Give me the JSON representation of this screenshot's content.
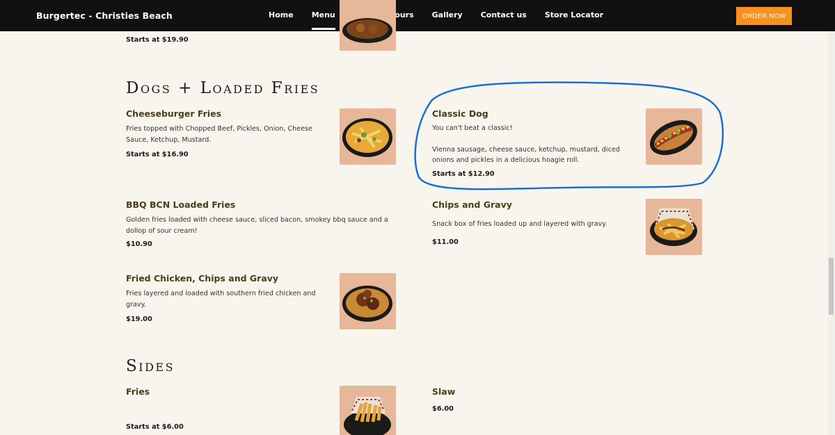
{
  "nav": {
    "brand": "Burgertec - Christies Beach",
    "links": [
      "Home",
      "Menu",
      "Trading Hours",
      "Gallery",
      "Contact us",
      "Store Locator"
    ],
    "order_label": "ORDER NOW"
  },
  "top_item": {
    "price": "Starts at $19.90"
  },
  "sections": [
    {
      "title": "Dogs + Loaded Fries",
      "items": [
        {
          "name": "Cheeseburger Fries",
          "desc": "Fries topped with Chopped Beef, Pickles, Onion, Cheese Sauce, Ketchup, Mustard.",
          "price": "Starts at $16.90"
        },
        {
          "name": "Classic Dog",
          "desc": "You can't beat a classic!",
          "desc2": "Vienna sausage, cheese sauce, ketchup, mustard, diced onions and pickles in a delicious hoagie roll.",
          "price": "Starts at $12.90"
        },
        {
          "name": "BBQ BCN Loaded Fries",
          "desc": "Golden fries loaded with cheese sauce, sliced bacon, smokey bbq sauce and a dollop of sour cream!",
          "price": "$10.90"
        },
        {
          "name": "Chips and Gravy",
          "desc": "Snack box of fries loaded up and layered with gravy.",
          "price": "$11.00"
        },
        {
          "name": "Fried Chicken, Chips and Gravy",
          "desc": "Fries layered and loaded with southern fried chicken and gravy.",
          "price": "$19.00"
        }
      ]
    },
    {
      "title": "Sides",
      "items": [
        {
          "name": "Fries",
          "price": "Starts at $6.00"
        },
        {
          "name": "Slaw",
          "price": "$6.00"
        }
      ]
    }
  ],
  "colors": {
    "nav_bg": "#121010",
    "accent": "#f7921e",
    "page_bg": "#f7f5ee",
    "annotation": "#1a6fd1"
  }
}
